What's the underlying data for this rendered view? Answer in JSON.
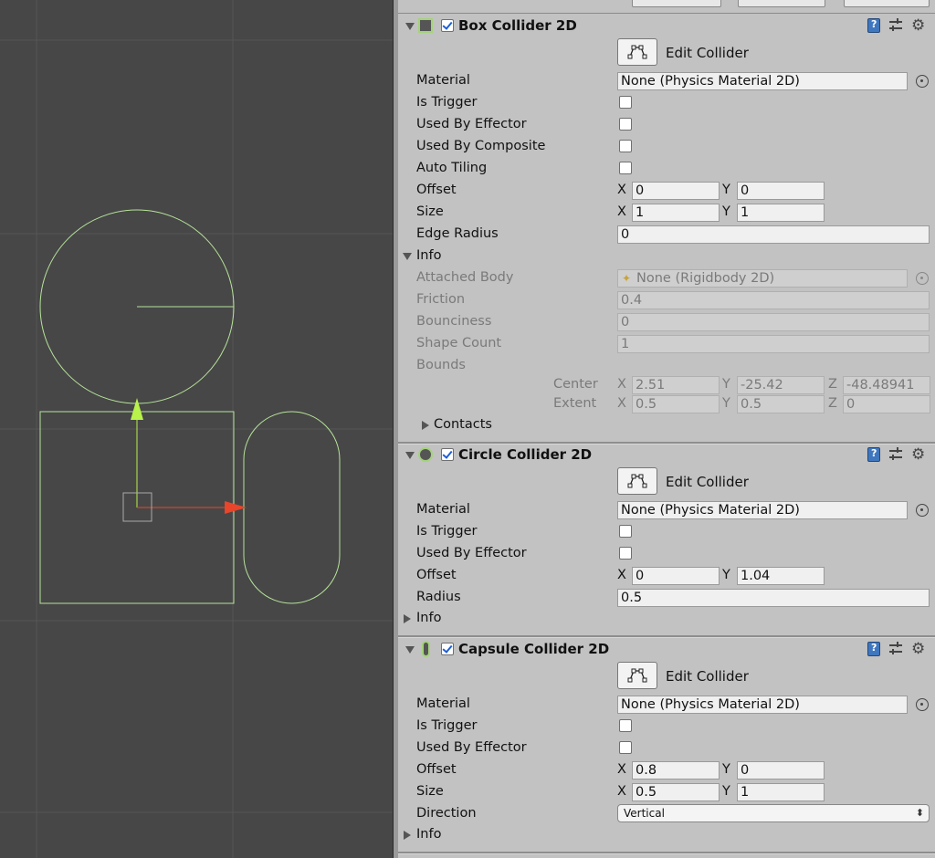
{
  "scene": {
    "gizmo_color": "#b6e39a",
    "x_axis_color": "#e8452a",
    "y_axis_color": "#b9f24a",
    "grid_color": "#555555"
  },
  "box": {
    "title": "Box Collider 2D",
    "enabled": true,
    "edit_collider_label": "Edit Collider",
    "material_label": "Material",
    "material_value": "None (Physics Material 2D)",
    "is_trigger_label": "Is Trigger",
    "used_by_effector_label": "Used By Effector",
    "used_by_composite_label": "Used By Composite",
    "auto_tiling_label": "Auto Tiling",
    "offset_label": "Offset",
    "offset_x": "0",
    "offset_y": "0",
    "size_label": "Size",
    "size_x": "1",
    "size_y": "1",
    "edge_radius_label": "Edge Radius",
    "edge_radius_value": "0",
    "info_label": "Info",
    "attached_body_label": "Attached Body",
    "attached_body_value": "None (Rigidbody 2D)",
    "friction_label": "Friction",
    "friction_value": "0.4",
    "bounciness_label": "Bounciness",
    "bounciness_value": "0",
    "shape_count_label": "Shape Count",
    "shape_count_value": "1",
    "bounds_label": "Bounds",
    "center_label": "Center",
    "center_x": "2.51",
    "center_y": "-25.42",
    "center_z": "-48.48941",
    "extent_label": "Extent",
    "extent_x": "0.5",
    "extent_y": "0.5",
    "extent_z": "0",
    "contacts_label": "Contacts"
  },
  "circle": {
    "title": "Circle Collider 2D",
    "enabled": true,
    "edit_collider_label": "Edit Collider",
    "material_label": "Material",
    "material_value": "None (Physics Material 2D)",
    "is_trigger_label": "Is Trigger",
    "used_by_effector_label": "Used By Effector",
    "offset_label": "Offset",
    "offset_x": "0",
    "offset_y": "1.04",
    "radius_label": "Radius",
    "radius_value": "0.5",
    "info_label": "Info"
  },
  "capsule": {
    "title": "Capsule Collider 2D",
    "enabled": true,
    "edit_collider_label": "Edit Collider",
    "material_label": "Material",
    "material_value": "None (Physics Material 2D)",
    "is_trigger_label": "Is Trigger",
    "used_by_effector_label": "Used By Effector",
    "offset_label": "Offset",
    "offset_x": "0.8",
    "offset_y": "0",
    "size_label": "Size",
    "size_x": "0.5",
    "size_y": "1",
    "direction_label": "Direction",
    "direction_value": "Vertical",
    "info_label": "Info"
  },
  "axes": {
    "x": "X",
    "y": "Y",
    "z": "Z"
  },
  "icons": {
    "help": "help-book-icon",
    "preset": "preset-sliders-icon",
    "settings": "gear-icon",
    "object_picker": "object-picker-icon",
    "edit_collider": "edit-collider-icon"
  }
}
